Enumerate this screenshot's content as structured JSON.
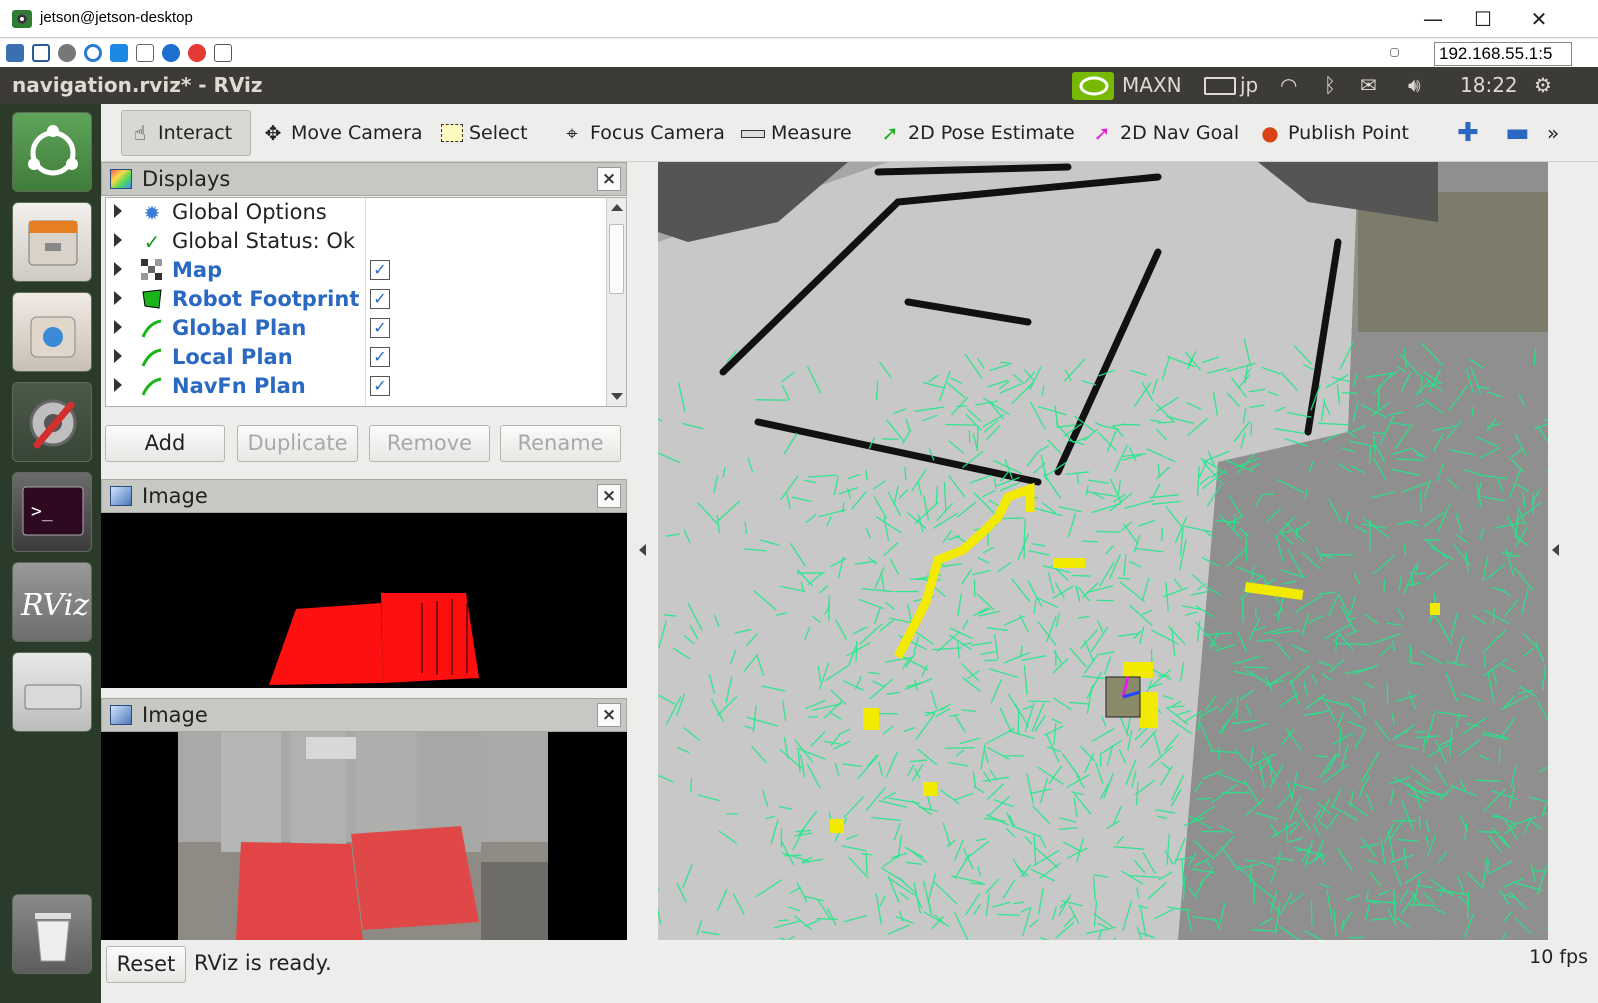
{
  "vnc": {
    "title": "jetson@jetson-desktop",
    "minimize": "—",
    "maximize": "☐",
    "close": "✕",
    "address": "192.168.55.1:5"
  },
  "topbar": {
    "window_title": "navigation.rviz* - RViz",
    "power_mode": "MAXN",
    "keyboard": "jp",
    "time": "18:22"
  },
  "toolbar": {
    "tools": [
      {
        "label": "Interact",
        "active": true
      },
      {
        "label": "Move Camera"
      },
      {
        "label": "Select"
      },
      {
        "label": "Focus Camera"
      },
      {
        "label": "Measure"
      },
      {
        "label": "2D Pose Estimate"
      },
      {
        "label": "2D Nav Goal"
      },
      {
        "label": "Publish Point"
      }
    ],
    "overflow": "»"
  },
  "displays": {
    "title": "Displays",
    "items": [
      {
        "label": "Global Options",
        "icon": "gear-icon"
      },
      {
        "label": "Global Status: Ok",
        "icon": "checkmark-icon"
      },
      {
        "label": "Map",
        "icon": "map-icon",
        "checked": true
      },
      {
        "label": "Robot Footprint",
        "icon": "polygon-icon",
        "checked": true
      },
      {
        "label": "Global Plan",
        "icon": "path-icon",
        "checked": true
      },
      {
        "label": "Local Plan",
        "icon": "path-icon",
        "checked": true
      },
      {
        "label": "NavFn Plan",
        "icon": "path-icon",
        "checked": true
      }
    ],
    "buttons": {
      "add": "Add",
      "duplicate": "Duplicate",
      "remove": "Remove",
      "rename": "Rename"
    }
  },
  "image_panels": [
    {
      "title": "Image"
    },
    {
      "title": "Image"
    }
  ],
  "status": {
    "reset": "Reset",
    "message": "RViz is ready.",
    "fps": "10 fps"
  },
  "colors": {
    "ubuntu_bar": "#3c3b37",
    "launcher": "#2b3b2a",
    "particles": "#22e88a",
    "plan": "#ffee00",
    "map_free": "#c9c9c9",
    "map_unknown": "#a6a6a6",
    "obstacles": "#111111",
    "depth_points": "#ff0000"
  }
}
